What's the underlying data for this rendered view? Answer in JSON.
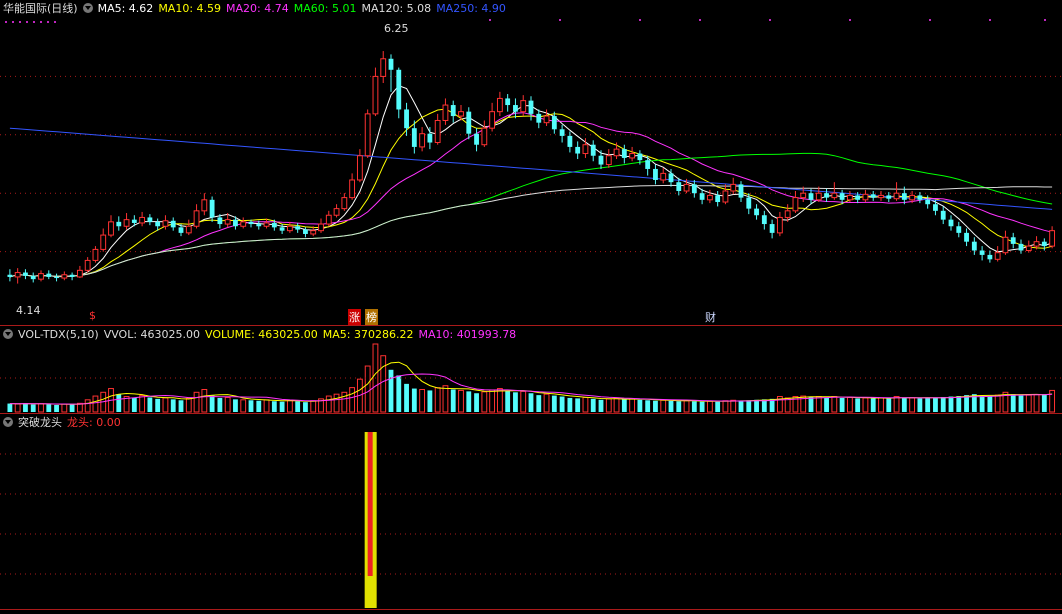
{
  "main": {
    "title": "华能国际(日线)",
    "ma_items": [
      {
        "label": "MA5: 4.62",
        "color": "#ffffff"
      },
      {
        "label": "MA10: 4.59",
        "color": "#ffff00"
      },
      {
        "label": "MA20: 4.74",
        "color": "#ff33ff"
      },
      {
        "label": "MA60: 5.01",
        "color": "#00ff00"
      },
      {
        "label": "MA120: 5.08",
        "color": "#dddddd"
      },
      {
        "label": "MA250: 4.90",
        "color": "#3355ff"
      }
    ],
    "high_label": "6.25",
    "low_label": "4.14",
    "markers": {
      "zhang": "涨",
      "bang": "榜",
      "cai": "财",
      "dollar": "$"
    }
  },
  "volume": {
    "title": "VOL-TDX(5,10)",
    "vol_label": "VVOL: 463025.00",
    "volume_label": "VOLUME: 463025.00",
    "ma5_label": "MA5: 370286.22",
    "ma10_label": "MA10: 401993.78"
  },
  "indicator": {
    "title": "突破龙头",
    "value_label": "龙头: 0.00"
  },
  "colors": {
    "up": "#ff3232",
    "down": "#54fcfc",
    "bg": "#000000",
    "grid": "#aa1a1a"
  },
  "chart_data": {
    "type": "candlestick",
    "price_range": [
      4.14,
      6.25
    ],
    "candles": [
      [
        4.22,
        4.2,
        4.27,
        4.16
      ],
      [
        4.2,
        4.24,
        4.28,
        4.14
      ],
      [
        4.24,
        4.21,
        4.27,
        4.18
      ],
      [
        4.21,
        4.18,
        4.24,
        4.15
      ],
      [
        4.18,
        4.23,
        4.26,
        4.16
      ],
      [
        4.23,
        4.2,
        4.26,
        4.18
      ],
      [
        4.2,
        4.19,
        4.23,
        4.16
      ],
      [
        4.19,
        4.22,
        4.25,
        4.17
      ],
      [
        4.22,
        4.2,
        4.24,
        4.17
      ],
      [
        4.2,
        4.26,
        4.3,
        4.19
      ],
      [
        4.26,
        4.35,
        4.38,
        4.24
      ],
      [
        4.35,
        4.45,
        4.48,
        4.33
      ],
      [
        4.45,
        4.58,
        4.64,
        4.43
      ],
      [
        4.58,
        4.7,
        4.76,
        4.56
      ],
      [
        4.7,
        4.66,
        4.75,
        4.62
      ],
      [
        4.66,
        4.72,
        4.78,
        4.63
      ],
      [
        4.72,
        4.69,
        4.76,
        4.66
      ],
      [
        4.69,
        4.74,
        4.79,
        4.66
      ],
      [
        4.74,
        4.7,
        4.77,
        4.67
      ],
      [
        4.7,
        4.66,
        4.73,
        4.62
      ],
      [
        4.66,
        4.71,
        4.76,
        4.63
      ],
      [
        4.71,
        4.65,
        4.74,
        4.62
      ],
      [
        4.65,
        4.6,
        4.68,
        4.57
      ],
      [
        4.6,
        4.66,
        4.72,
        4.58
      ],
      [
        4.66,
        4.8,
        4.86,
        4.64
      ],
      [
        4.8,
        4.9,
        4.96,
        4.76
      ],
      [
        4.9,
        4.74,
        4.93,
        4.7
      ],
      [
        4.74,
        4.68,
        4.77,
        4.64
      ],
      [
        4.68,
        4.72,
        4.78,
        4.65
      ],
      [
        4.72,
        4.66,
        4.75,
        4.63
      ],
      [
        4.66,
        4.7,
        4.74,
        4.64
      ],
      [
        4.7,
        4.68,
        4.72,
        4.65
      ],
      [
        4.68,
        4.66,
        4.71,
        4.63
      ],
      [
        4.66,
        4.69,
        4.73,
        4.64
      ],
      [
        4.69,
        4.65,
        4.72,
        4.62
      ],
      [
        4.65,
        4.62,
        4.68,
        4.59
      ],
      [
        4.62,
        4.66,
        4.7,
        4.6
      ],
      [
        4.66,
        4.63,
        4.69,
        4.6
      ],
      [
        4.63,
        4.59,
        4.65,
        4.56
      ],
      [
        4.59,
        4.62,
        4.66,
        4.57
      ],
      [
        4.62,
        4.68,
        4.73,
        4.6
      ],
      [
        4.68,
        4.76,
        4.8,
        4.66
      ],
      [
        4.76,
        4.82,
        4.86,
        4.74
      ],
      [
        4.82,
        4.92,
        4.96,
        4.8
      ],
      [
        4.92,
        5.08,
        5.14,
        4.9
      ],
      [
        5.08,
        5.3,
        5.36,
        5.06
      ],
      [
        5.3,
        5.68,
        5.72,
        5.28
      ],
      [
        5.68,
        6.02,
        6.1,
        5.66
      ],
      [
        6.02,
        6.18,
        6.25,
        5.96
      ],
      [
        6.18,
        6.08,
        6.22,
        5.88
      ],
      [
        6.08,
        5.72,
        6.1,
        5.64
      ],
      [
        5.72,
        5.55,
        5.78,
        5.48
      ],
      [
        5.55,
        5.38,
        5.62,
        5.32
      ],
      [
        5.38,
        5.5,
        5.56,
        5.34
      ],
      [
        5.5,
        5.42,
        5.56,
        5.36
      ],
      [
        5.42,
        5.62,
        5.68,
        5.4
      ],
      [
        5.62,
        5.76,
        5.82,
        5.58
      ],
      [
        5.76,
        5.66,
        5.8,
        5.6
      ],
      [
        5.66,
        5.7,
        5.76,
        5.62
      ],
      [
        5.7,
        5.5,
        5.74,
        5.45
      ],
      [
        5.5,
        5.4,
        5.55,
        5.34
      ],
      [
        5.4,
        5.55,
        5.62,
        5.38
      ],
      [
        5.55,
        5.7,
        5.78,
        5.52
      ],
      [
        5.7,
        5.82,
        5.88,
        5.66
      ],
      [
        5.82,
        5.76,
        5.86,
        5.7
      ],
      [
        5.76,
        5.7,
        5.82,
        5.64
      ],
      [
        5.7,
        5.8,
        5.85,
        5.66
      ],
      [
        5.8,
        5.68,
        5.84,
        5.62
      ],
      [
        5.68,
        5.6,
        5.72,
        5.55
      ],
      [
        5.6,
        5.66,
        5.72,
        5.57
      ],
      [
        5.66,
        5.54,
        5.7,
        5.5
      ],
      [
        5.54,
        5.48,
        5.58,
        5.42
      ],
      [
        5.48,
        5.38,
        5.52,
        5.33
      ],
      [
        5.38,
        5.32,
        5.43,
        5.27
      ],
      [
        5.32,
        5.4,
        5.46,
        5.28
      ],
      [
        5.4,
        5.3,
        5.44,
        5.25
      ],
      [
        5.3,
        5.22,
        5.35,
        5.18
      ],
      [
        5.22,
        5.3,
        5.36,
        5.19
      ],
      [
        5.3,
        5.36,
        5.42,
        5.27
      ],
      [
        5.36,
        5.28,
        5.4,
        5.23
      ],
      [
        5.28,
        5.32,
        5.38,
        5.25
      ],
      [
        5.32,
        5.26,
        5.35,
        5.22
      ],
      [
        5.26,
        5.18,
        5.3,
        5.12
      ],
      [
        5.18,
        5.08,
        5.22,
        5.04
      ],
      [
        5.08,
        5.14,
        5.19,
        5.05
      ],
      [
        5.14,
        5.06,
        5.18,
        5.02
      ],
      [
        5.06,
        4.98,
        5.1,
        4.94
      ],
      [
        4.98,
        5.04,
        5.09,
        4.96
      ],
      [
        5.04,
        4.96,
        5.08,
        4.92
      ],
      [
        4.96,
        4.9,
        5.0,
        4.86
      ],
      [
        4.9,
        4.94,
        4.99,
        4.87
      ],
      [
        4.94,
        4.88,
        4.98,
        4.84
      ],
      [
        4.88,
        4.98,
        5.04,
        4.86
      ],
      [
        4.98,
        5.04,
        5.1,
        4.95
      ],
      [
        5.04,
        4.92,
        5.07,
        4.88
      ],
      [
        4.92,
        4.82,
        4.96,
        4.77
      ],
      [
        4.82,
        4.76,
        4.86,
        4.72
      ],
      [
        4.76,
        4.68,
        4.8,
        4.63
      ],
      [
        4.68,
        4.6,
        4.72,
        4.55
      ],
      [
        4.6,
        4.74,
        4.79,
        4.57
      ],
      [
        4.74,
        4.8,
        4.86,
        4.7
      ],
      [
        4.8,
        4.92,
        4.98,
        4.78
      ],
      [
        4.92,
        4.96,
        5.02,
        4.88
      ],
      [
        4.96,
        4.9,
        5.0,
        4.86
      ],
      [
        4.9,
        4.96,
        5.02,
        4.88
      ],
      [
        4.96,
        4.92,
        5.0,
        4.88
      ],
      [
        4.92,
        4.96,
        5.06,
        4.9
      ],
      [
        4.96,
        4.9,
        4.99,
        4.86
      ],
      [
        4.9,
        4.94,
        4.98,
        4.88
      ],
      [
        4.94,
        4.9,
        4.97,
        4.87
      ],
      [
        4.9,
        4.95,
        4.99,
        4.88
      ],
      [
        4.95,
        4.92,
        4.98,
        4.89
      ],
      [
        4.92,
        4.94,
        4.98,
        4.89
      ],
      [
        4.94,
        4.91,
        4.97,
        4.88
      ],
      [
        4.91,
        4.96,
        5.06,
        4.89
      ],
      [
        4.96,
        4.9,
        5.02,
        4.86
      ],
      [
        4.9,
        4.94,
        4.98,
        4.87
      ],
      [
        4.94,
        4.9,
        4.97,
        4.87
      ],
      [
        4.9,
        4.86,
        4.94,
        4.82
      ],
      [
        4.86,
        4.8,
        4.9,
        4.76
      ],
      [
        4.8,
        4.72,
        4.84,
        4.68
      ],
      [
        4.72,
        4.66,
        4.76,
        4.62
      ],
      [
        4.66,
        4.6,
        4.7,
        4.56
      ],
      [
        4.6,
        4.52,
        4.64,
        4.48
      ],
      [
        4.52,
        4.44,
        4.56,
        4.4
      ],
      [
        4.44,
        4.4,
        4.48,
        4.35
      ],
      [
        4.4,
        4.36,
        4.44,
        4.33
      ],
      [
        4.36,
        4.42,
        4.48,
        4.34
      ],
      [
        4.42,
        4.56,
        4.62,
        4.4
      ],
      [
        4.56,
        4.5,
        4.6,
        4.46
      ],
      [
        4.5,
        4.44,
        4.54,
        4.41
      ],
      [
        4.44,
        4.48,
        4.53,
        4.42
      ],
      [
        4.48,
        4.52,
        4.57,
        4.45
      ],
      [
        4.52,
        4.48,
        4.55,
        4.44
      ],
      [
        4.48,
        4.62,
        4.66,
        4.46
      ]
    ],
    "volume": [
      180,
      170,
      190,
      160,
      175,
      165,
      150,
      170,
      160,
      185,
      260,
      340,
      420,
      500,
      380,
      330,
      300,
      350,
      310,
      280,
      300,
      270,
      250,
      290,
      420,
      480,
      350,
      300,
      310,
      270,
      260,
      250,
      240,
      260,
      230,
      220,
      250,
      230,
      210,
      240,
      280,
      340,
      380,
      420,
      520,
      700,
      980,
      1450,
      1200,
      900,
      780,
      600,
      500,
      480,
      460,
      520,
      560,
      480,
      460,
      440,
      400,
      430,
      470,
      500,
      450,
      420,
      440,
      400,
      360,
      380,
      350,
      330,
      300,
      290,
      310,
      280,
      260,
      280,
      290,
      270,
      280,
      260,
      250,
      240,
      250,
      240,
      230,
      240,
      230,
      220,
      230,
      220,
      240,
      250,
      240,
      250,
      260,
      270,
      280,
      330,
      300,
      330,
      340,
      320,
      330,
      310,
      330,
      300,
      310,
      290,
      300,
      290,
      300,
      290,
      330,
      310,
      300,
      290,
      300,
      310,
      320,
      330,
      340,
      360,
      380,
      350,
      340,
      360,
      420,
      380,
      350,
      360,
      370,
      380,
      460
    ],
    "indicator_values": [
      0,
      0,
      0,
      0,
      0,
      0,
      0,
      0,
      0,
      0,
      0,
      0,
      0,
      0,
      0,
      0,
      0,
      0,
      0,
      0,
      0,
      0,
      0,
      0,
      0,
      0,
      0,
      0,
      0,
      0,
      0,
      0,
      0,
      0,
      0,
      0,
      0,
      0,
      0,
      0,
      0,
      0,
      0,
      0,
      0,
      0,
      1,
      0,
      0,
      0,
      0,
      0,
      0,
      0,
      0,
      0,
      0,
      0,
      0,
      0,
      0,
      0,
      0,
      0,
      0,
      0,
      0,
      0,
      0,
      0,
      0,
      0,
      0,
      0,
      0,
      0,
      0,
      0,
      0,
      0,
      0,
      0,
      0,
      0,
      0,
      0,
      0,
      0,
      0,
      0,
      0,
      0,
      0,
      0,
      0,
      0,
      0,
      0,
      0,
      0,
      0,
      0,
      0,
      0,
      0,
      0,
      0,
      0,
      0,
      0,
      0,
      0,
      0,
      0,
      0,
      0,
      0,
      0,
      0,
      0,
      0,
      0,
      0,
      0,
      0,
      0,
      0,
      0,
      0,
      0,
      0,
      0,
      0,
      0,
      0
    ]
  }
}
